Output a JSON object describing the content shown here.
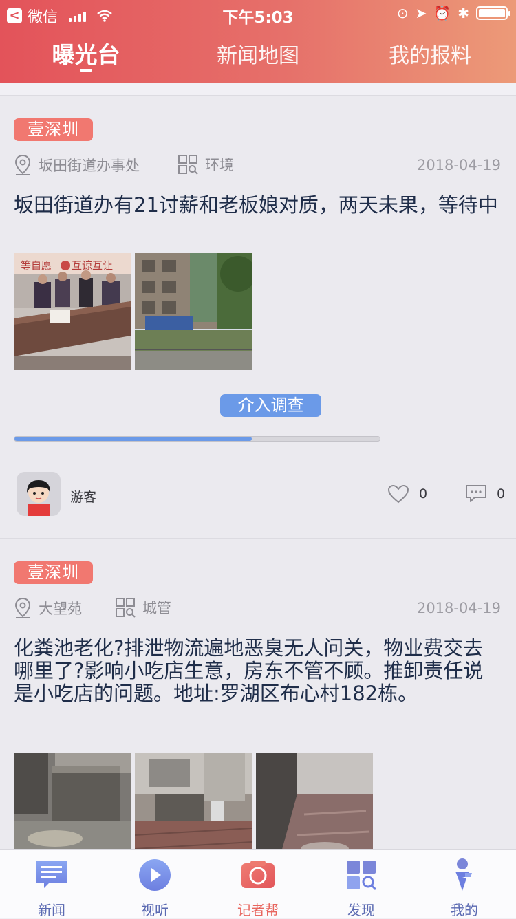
{
  "status_bar": {
    "back_app": "微信",
    "time": "下午5:03"
  },
  "tabs": [
    {
      "label": "曝光台",
      "active": true
    },
    {
      "label": "新闻地图",
      "active": false
    },
    {
      "label": "我的报料",
      "active": false
    }
  ],
  "posts": [
    {
      "tag": "壹深圳",
      "location": "坂田街道办事处",
      "category": "环境",
      "date": "2018-04-19",
      "title": "坂田街道办有21讨薪和老板娘对质，两天未果，等待中",
      "status": "介入调查",
      "progress": 0.65,
      "user": "游客",
      "likes": "0",
      "comments": "0",
      "thumb_signs": [
        "等自愿",
        "互谅互让"
      ]
    },
    {
      "tag": "壹深圳",
      "location": "大望苑",
      "category": "城管",
      "date": "2018-04-19",
      "title": "化粪池老化?排泄物流遍地恶臭无人问关，物业费交去哪里了?影响小吃店生意，房东不管不顾。推卸责任说是小吃店的问题。地址:罗湖区布心村182栋。"
    }
  ],
  "bottom_nav": [
    {
      "label": "新闻",
      "icon": "news-chat-icon"
    },
    {
      "label": "视听",
      "icon": "play-circle-icon"
    },
    {
      "label": "记者帮",
      "icon": "camera-icon",
      "active": true
    },
    {
      "label": "发现",
      "icon": "discover-grid-icon"
    },
    {
      "label": "我的",
      "icon": "profile-icon"
    }
  ],
  "colors": {
    "accent": "#e3535a",
    "tag": "#f17870",
    "status": "#6b9ae8",
    "nav": "#5b6ab2"
  }
}
